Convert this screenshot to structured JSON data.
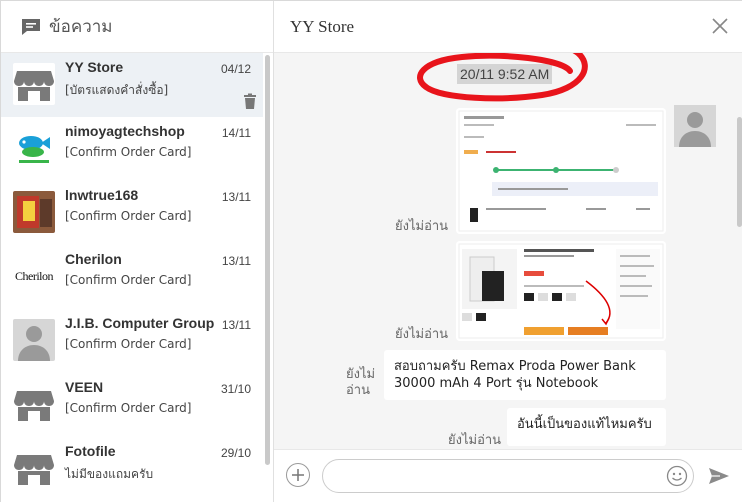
{
  "sidebar": {
    "title": "ข้อความ",
    "icon": "chat-icon"
  },
  "conversations": [
    {
      "name": "YY Store",
      "date": "04/12",
      "preview": "[บัตรแสดงคำสั่งซื้อ]",
      "avatar": "store-icon",
      "active": true
    },
    {
      "name": "nimoyagtechshop",
      "date": "14/11",
      "preview": "[Confirm Order Card]",
      "avatar": "fish-logo"
    },
    {
      "name": "lnwtrue168",
      "date": "13/11",
      "preview": "[Confirm Order Card]",
      "avatar": "photo"
    },
    {
      "name": "Cherilon",
      "date": "13/11",
      "preview": "[Confirm Order Card]",
      "avatar": "cherilon-logo",
      "logo_text": "Cherilon"
    },
    {
      "name": "J.I.B. Computer Group",
      "date": "13/11",
      "preview": "[Confirm Order Card]",
      "avatar": "person-icon"
    },
    {
      "name": "VEEN",
      "date": "31/10",
      "preview": "[Confirm Order Card]",
      "avatar": "store-icon"
    },
    {
      "name": "Fotofile",
      "date": "29/10",
      "preview": "ไม่มีของแถมครับ",
      "avatar": "store-icon"
    }
  ],
  "chat": {
    "store_name": "YY Store",
    "timestamp": "20/11 9:52 AM",
    "messages": [
      {
        "type": "image",
        "status": "ยังไม่อ่าน"
      },
      {
        "type": "image",
        "status": "ยังไม่อ่าน"
      },
      {
        "type": "text",
        "status": "ยังไม่\nอ่าน",
        "text": "สอบถามครับ Remax Proda Power Bank 30000 mAh 4 Port รุ่น Notebook"
      },
      {
        "type": "text",
        "status": "ยังไม่อ่าน",
        "text": "อันนี้เป็นของแท้ไหมครับ"
      }
    ],
    "status_line1": "ยังไม่",
    "status_line2": "อ่าน"
  },
  "composer": {
    "placeholder": ""
  },
  "colors": {
    "scribble": "#e8141b",
    "active_row": "#edf1f5",
    "chat_bg": "#f5f5f5",
    "timestamp_bg": "#d4d4d4"
  }
}
